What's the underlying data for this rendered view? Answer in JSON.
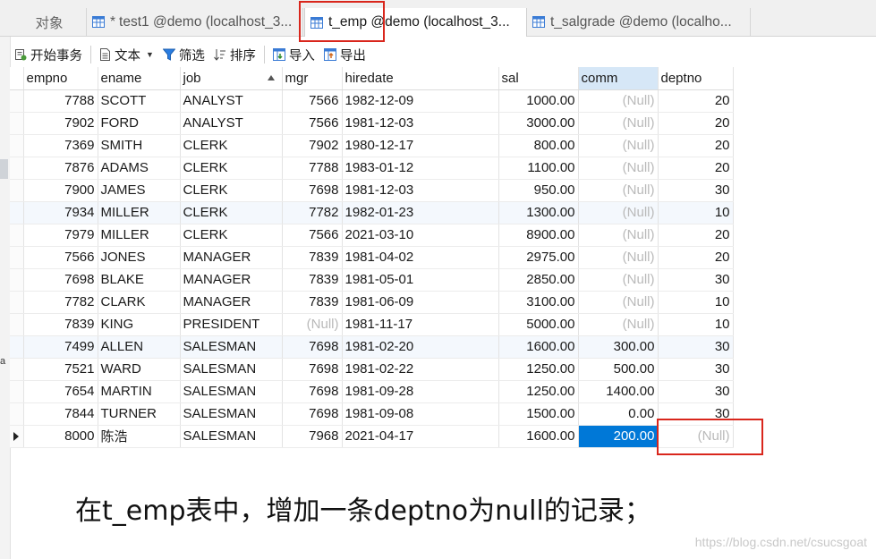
{
  "tabs": [
    {
      "label": "对象",
      "active": false
    },
    {
      "label": "test1 @demo (localhost_3...",
      "modified": true,
      "active": false
    },
    {
      "label": "t_emp @demo (localhost_3...",
      "active": true
    },
    {
      "label": "t_salgrade @demo (localho...",
      "active": false
    }
  ],
  "toolbar": {
    "begin_transaction": "开始事务",
    "text": "文本",
    "filter": "筛选",
    "sort": "排序",
    "import": "导入",
    "export": "导出"
  },
  "grid": {
    "columns": [
      "empno",
      "ename",
      "job",
      "mgr",
      "hiredate",
      "sal",
      "comm",
      "deptno"
    ],
    "sorted_column": "job",
    "selected_column": "comm",
    "null_text": "(Null)",
    "rows": [
      [
        "7788",
        "SCOTT",
        "ANALYST",
        "7566",
        "1982-12-09",
        "1000.00",
        null,
        "20"
      ],
      [
        "7902",
        "FORD",
        "ANALYST",
        "7566",
        "1981-12-03",
        "3000.00",
        null,
        "20"
      ],
      [
        "7369",
        "SMITH",
        "CLERK",
        "7902",
        "1980-12-17",
        "800.00",
        null,
        "20"
      ],
      [
        "7876",
        "ADAMS",
        "CLERK",
        "7788",
        "1983-01-12",
        "1100.00",
        null,
        "20"
      ],
      [
        "7900",
        "JAMES",
        "CLERK",
        "7698",
        "1981-12-03",
        "950.00",
        null,
        "30"
      ],
      [
        "7934",
        "MILLER",
        "CLERK",
        "7782",
        "1982-01-23",
        "1300.00",
        null,
        "10"
      ],
      [
        "7979",
        "MILLER",
        "CLERK",
        "7566",
        "2021-03-10",
        "8900.00",
        null,
        "20"
      ],
      [
        "7566",
        "JONES",
        "MANAGER",
        "7839",
        "1981-04-02",
        "2975.00",
        null,
        "20"
      ],
      [
        "7698",
        "BLAKE",
        "MANAGER",
        "7839",
        "1981-05-01",
        "2850.00",
        null,
        "30"
      ],
      [
        "7782",
        "CLARK",
        "MANAGER",
        "7839",
        "1981-06-09",
        "3100.00",
        null,
        "10"
      ],
      [
        "7839",
        "KING",
        "PRESIDENT",
        null,
        "1981-11-17",
        "5000.00",
        null,
        "10"
      ],
      [
        "7499",
        "ALLEN",
        "SALESMAN",
        "7698",
        "1981-02-20",
        "1600.00",
        "300.00",
        "30"
      ],
      [
        "7521",
        "WARD",
        "SALESMAN",
        "7698",
        "1981-02-22",
        "1250.00",
        "500.00",
        "30"
      ],
      [
        "7654",
        "MARTIN",
        "SALESMAN",
        "7698",
        "1981-09-28",
        "1250.00",
        "1400.00",
        "30"
      ],
      [
        "7844",
        "TURNER",
        "SALESMAN",
        "7698",
        "1981-09-08",
        "1500.00",
        "0.00",
        "30"
      ],
      [
        "8000",
        "陈浩",
        "SALESMAN",
        "7968",
        "2021-04-17",
        "1600.00",
        "200.00",
        null
      ]
    ],
    "current_row": 15,
    "highlight_rows": [
      5,
      11
    ]
  },
  "caption": "在t_emp表中，增加一条deptno为null的记录；",
  "watermark": "https://blog.csdn.net/csucsgoat",
  "colors": {
    "selection": "#0078d7",
    "highlight_box": "#d9261c",
    "null_text": "#b9b9b9",
    "column_header_selected": "#d6e7f7"
  }
}
